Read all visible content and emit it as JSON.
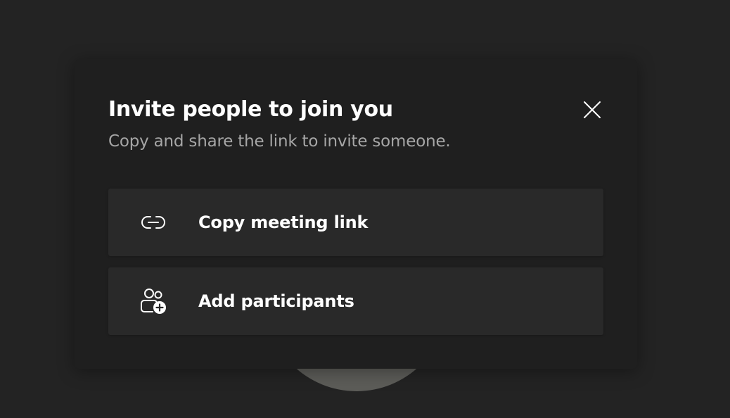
{
  "dialog": {
    "title": "Invite people to join you",
    "subtitle": "Copy and share the link to invite someone.",
    "close_icon": "close-icon"
  },
  "actions": [
    {
      "label": "Copy meeting link",
      "icon": "link-icon"
    },
    {
      "label": "Add participants",
      "icon": "add-people-icon"
    }
  ],
  "colors": {
    "background": "#232323",
    "dialog": "#1f1f1f",
    "action_bg": "#292929",
    "text_primary": "#ffffff",
    "text_secondary": "#a6a6a6",
    "avatar_bg": "#5c5c58"
  }
}
